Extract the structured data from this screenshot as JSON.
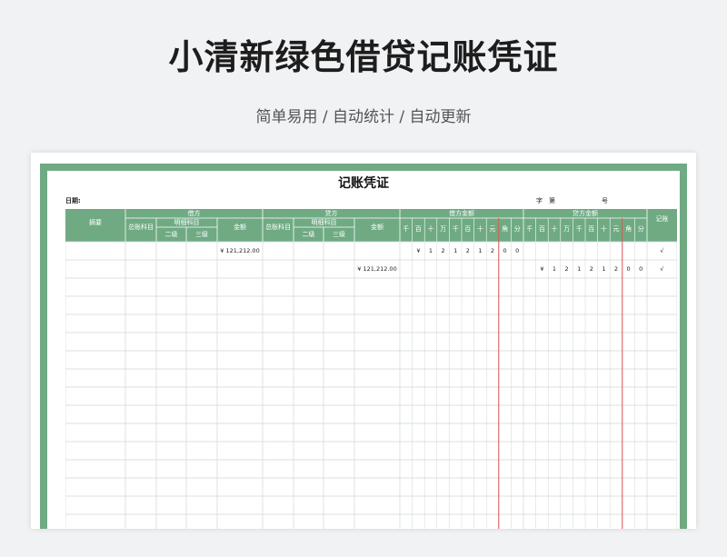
{
  "page": {
    "title": "小清新绿色借贷记账凭证",
    "subtitle": "简单易用 / 自动统计 / 自动更新"
  },
  "voucher": {
    "title": "记账凭证",
    "date_label": "日期:",
    "zi": "字",
    "di": "第",
    "hao": "号",
    "headers": {
      "summary": "摘要",
      "debit": "借方",
      "credit": "贷方",
      "general_account": "总账科目",
      "detail_account": "明细科目",
      "level2": "二级",
      "level3": "三级",
      "amount": "金额",
      "debit_amount": "借方金额",
      "credit_amount": "贷方金额",
      "posted": "记账",
      "digits": [
        "千",
        "百",
        "十",
        "万",
        "千",
        "百",
        "十",
        "元",
        "角",
        "分"
      ]
    },
    "rows": [
      {
        "debit_amount": "¥  121,212.00",
        "credit_amount": "",
        "debit_digits": [
          "",
          "¥",
          "1",
          "2",
          "1",
          "2",
          "1",
          "2",
          "0",
          "0"
        ],
        "credit_digits": [
          "",
          "",
          "",
          "",
          "",
          "",
          "",
          "",
          "",
          ""
        ],
        "check": "√"
      },
      {
        "debit_amount": "",
        "credit_amount": "¥  121,212.00",
        "debit_digits": [
          "",
          "",
          "",
          "",
          "",
          "",
          "",
          "",
          "",
          ""
        ],
        "credit_digits": [
          "",
          "¥",
          "1",
          "2",
          "1",
          "2",
          "1",
          "2",
          "0",
          "0"
        ],
        "check": "√"
      }
    ]
  },
  "colors": {
    "green": "#6faa83",
    "red_line": "#d9534f",
    "grid_line": "#cfd8d2"
  }
}
